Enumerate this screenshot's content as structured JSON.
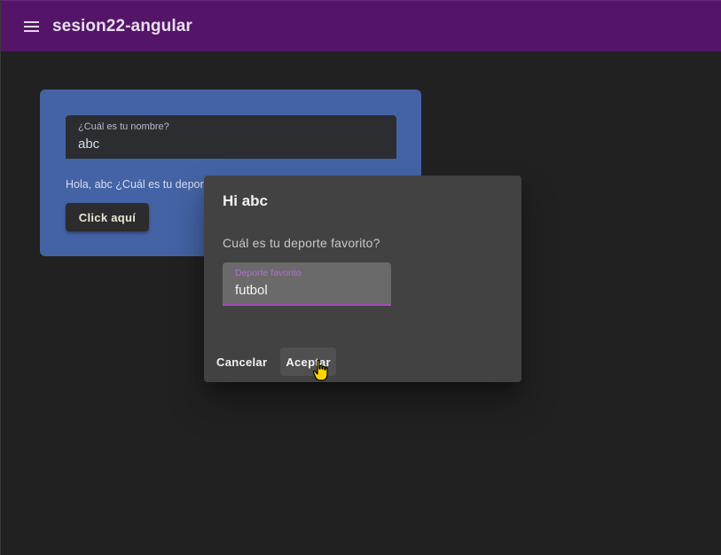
{
  "toolbar": {
    "menu_icon": "menu-icon",
    "title": "sesion22-angular"
  },
  "card": {
    "name_field": {
      "label": "¿Cuál es tu nombre?",
      "value": "abc"
    },
    "greeting": "Hola, abc ¿Cuál es tu depor",
    "button_label": "Click aquí"
  },
  "dialog": {
    "title": "Hi abc",
    "question": "Cuál es tu deporte favorito?",
    "sport_field": {
      "label": "Deporte favorito",
      "value": "futbol"
    },
    "cancel_label": "Cancelar",
    "accept_label": "Aceptar"
  },
  "colors": {
    "toolbar": "#541569",
    "background": "#212121",
    "card": "#4463a5",
    "dialog": "#424242",
    "accent": "#a14bbe"
  }
}
